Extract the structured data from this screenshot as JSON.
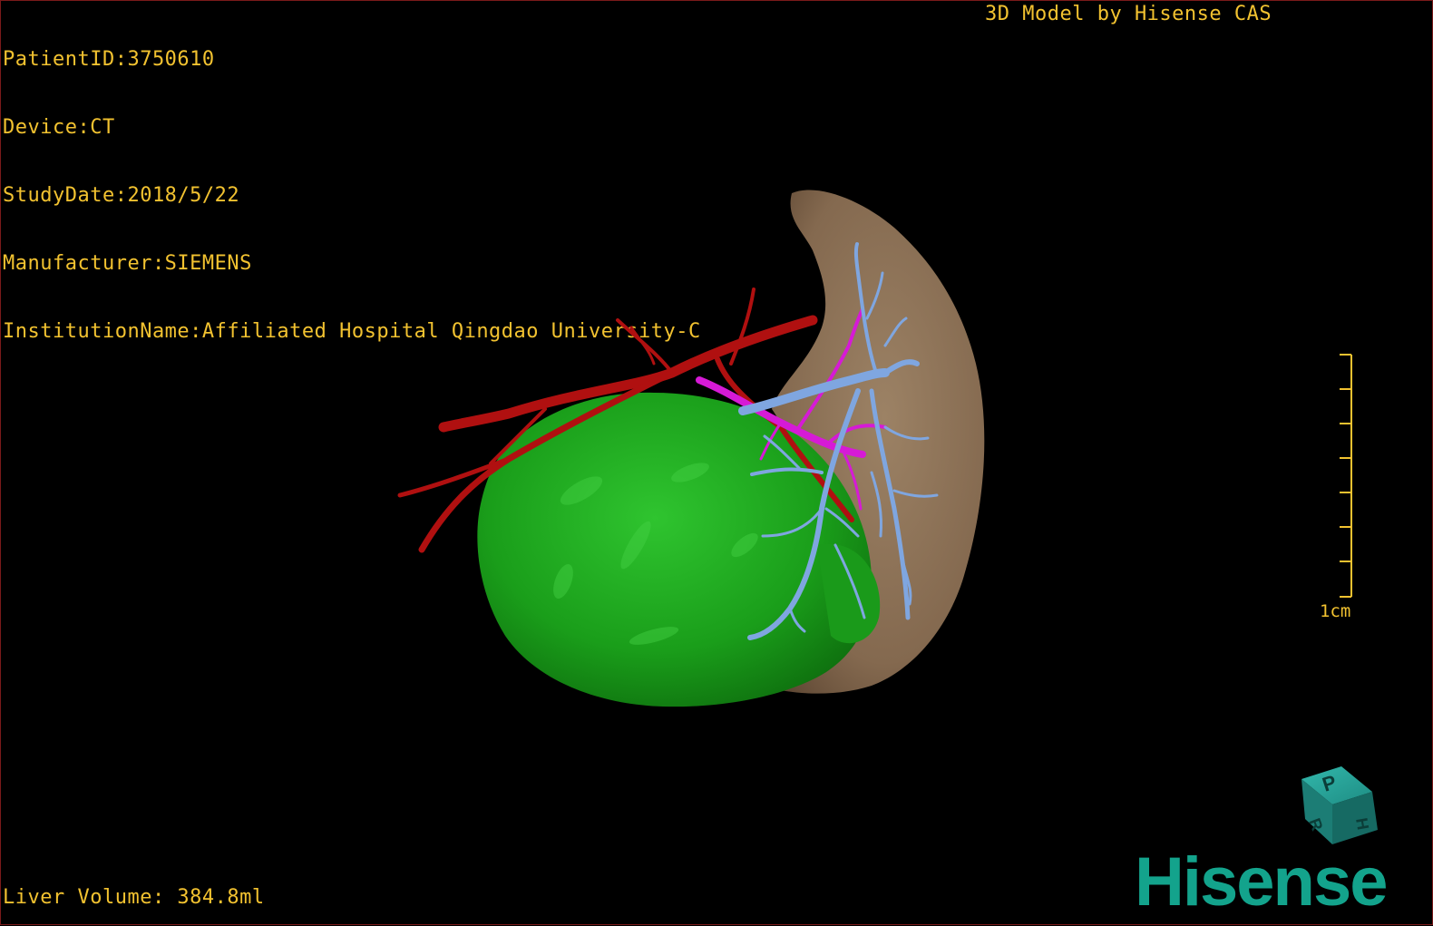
{
  "header": {
    "patient_id": "PatientID:3750610",
    "device": "Device:CT",
    "study_date": "StudyDate:2018/5/22",
    "manufacturer": "Manufacturer:SIEMENS",
    "institution": "InstitutionName:Affiliated Hospital Qingdao University-C"
  },
  "credit": "3D Model by Hisense CAS",
  "footer": {
    "liver_volume": "Liver Volume: 384.8ml"
  },
  "scale_bar": {
    "label": "1cm"
  },
  "orientation_cube": {
    "faces": [
      "P",
      "H",
      "R"
    ],
    "color": "#1f8f86"
  },
  "brand": {
    "logo_text": "Hisense",
    "color": "#13a38c"
  },
  "model": {
    "structures": [
      {
        "name": "liver",
        "color": "#8a7259"
      },
      {
        "name": "tumor",
        "color": "#1fa61f"
      },
      {
        "name": "hepatic-artery",
        "color": "#b01010"
      },
      {
        "name": "portal-vein",
        "color": "#d61ad6"
      },
      {
        "name": "hepatic-vein",
        "color": "#7fa6e0"
      }
    ]
  },
  "colors": {
    "overlay_text": "#f2c230",
    "background": "#000000",
    "frame": "#7a1a1a"
  }
}
